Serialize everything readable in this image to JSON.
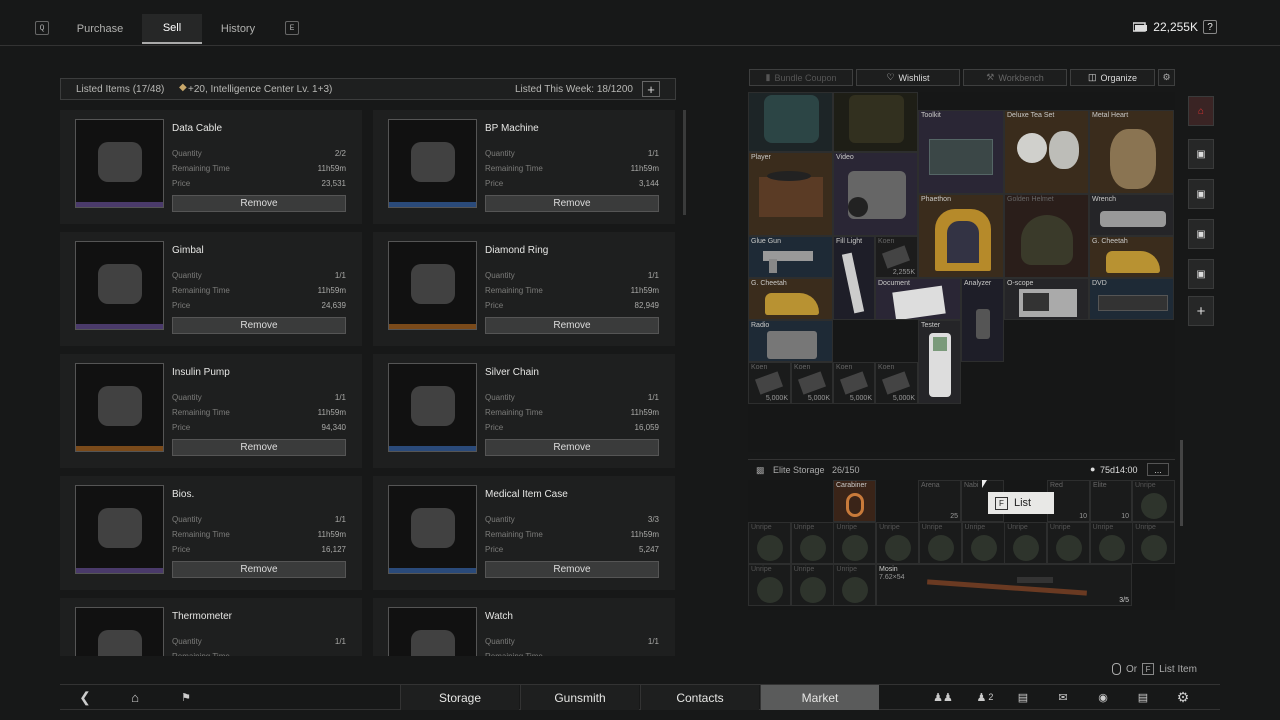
{
  "tabs": {
    "q_key": "Q",
    "purchase": "Purchase",
    "sell": "Sell",
    "history": "History",
    "e_key": "E"
  },
  "currency": {
    "amount": "22,255K",
    "help": "?"
  },
  "listing": {
    "listed_items": "Listed Items (17/48)",
    "bonus": "+20, Intelligence Center Lv. 1+3)",
    "listed_this_week": "Listed This Week: 18/1200",
    "plus": "+"
  },
  "labels": {
    "quantity": "Quantity",
    "remaining_time": "Remaining Time",
    "price": "Price",
    "remove": "Remove"
  },
  "items": [
    {
      "name": "Data Cable",
      "quantity": "2/2",
      "time": "11h59m",
      "price": "23,531",
      "rarity": "#4a3a6a"
    },
    {
      "name": "BP Machine",
      "quantity": "1/1",
      "time": "11h59m",
      "price": "3,144",
      "rarity": "#2a4a7a"
    },
    {
      "name": "Gimbal",
      "quantity": "1/1",
      "time": "11h59m",
      "price": "24,639",
      "rarity": "#4a3a6a"
    },
    {
      "name": "Diamond Ring",
      "quantity": "1/1",
      "time": "11h59m",
      "price": "82,949",
      "rarity": "#7a4a1a"
    },
    {
      "name": "Insulin Pump",
      "quantity": "1/1",
      "time": "11h59m",
      "price": "94,340",
      "rarity": "#7a4a1a"
    },
    {
      "name": "Silver Chain",
      "quantity": "1/1",
      "time": "11h59m",
      "price": "16,059",
      "rarity": "#2a4a7a"
    },
    {
      "name": "Bios.",
      "quantity": "1/1",
      "time": "11h59m",
      "price": "16,127",
      "rarity": "#4a3a6a"
    },
    {
      "name": "Medical Item Case",
      "quantity": "3/3",
      "time": "11h59m",
      "price": "5,247",
      "rarity": "#2a4a7a"
    },
    {
      "name": "Thermometer",
      "quantity": "1/1",
      "time": "",
      "price": "",
      "rarity": "#4a3a6a"
    },
    {
      "name": "Watch",
      "quantity": "1/1",
      "time": "",
      "price": "",
      "rarity": "#2a4a7a"
    }
  ],
  "right_tabs": {
    "bundle": "Bundle Coupon",
    "wishlist": "Wishlist",
    "workbench": "Workbench",
    "organize": "Organize"
  },
  "stash": {
    "toolkit": "Toolkit",
    "deluxe_tea_set": "Deluxe Tea Set",
    "metal_heart": "Metal Heart",
    "player": "Player",
    "video": "Video",
    "phaethon": "Phaethon",
    "golden_helmet": "Golden Helmet",
    "wrench": "Wrench",
    "glue_gun": "Glue Gun",
    "fill_light": "Fill Light",
    "koen": "Koen",
    "koen_qty": "2,255K",
    "g_cheetah": "G. Cheetah",
    "document": "Document",
    "analyzer": "Analyzer",
    "o_scope": "O-scope",
    "dvd": "DVD",
    "radio": "Radio",
    "tester": "Tester",
    "koen_5000": "5,000K"
  },
  "elite": {
    "title": "Elite Storage",
    "count": "26/150",
    "time": "75d14:00",
    "more": "...",
    "carabiner": "Carabiner",
    "arena": "Arena",
    "nabi": "Nabi",
    "unripe": "Unripe",
    "mosin": "Mosin",
    "caliber": "7.62×54",
    "mosin_qty": "3/5",
    "qty_25": "25",
    "qty_10": "10",
    "red": "Red",
    "elite_label": "Elite"
  },
  "tooltip": {
    "key": "F",
    "label": "List"
  },
  "hint": {
    "or": "Or",
    "key": "F",
    "label": "List Item"
  },
  "bottom": {
    "storage": "Storage",
    "gunsmith": "Gunsmith",
    "contacts": "Contacts",
    "market": "Market",
    "players_count": "2"
  },
  "colors": {
    "epic": "#4a3a6a",
    "rare": "#2a4a7a",
    "legendary": "#7a4a1a"
  }
}
